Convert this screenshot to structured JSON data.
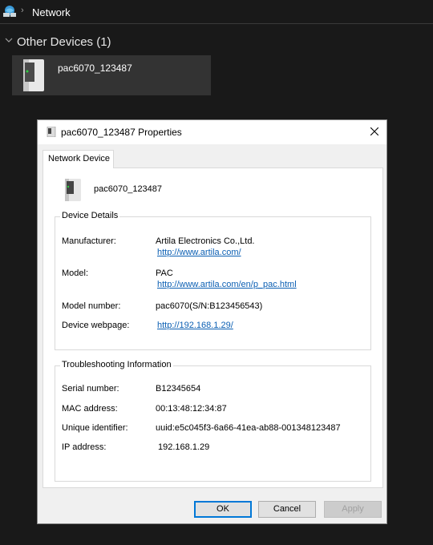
{
  "explorer": {
    "breadcrumb": "Network",
    "group_title": "Other Devices (1)",
    "device_name": "pac6070_123487"
  },
  "dialog": {
    "title": "pac6070_123487 Properties",
    "tab_label": "Network Device",
    "device_name": "pac6070_123487",
    "device_details": {
      "legend": "Device Details",
      "manufacturer_label": "Manufacturer:",
      "manufacturer_value": "Artila Electronics Co.,Ltd.",
      "manufacturer_link": "http://www.artila.com/",
      "model_label": "Model:",
      "model_value": "PAC",
      "model_link": "http://www.artila.com/en/p_pac.html",
      "model_number_label": "Model number:",
      "model_number_value": "pac6070(S/N:B123456543)",
      "webpage_label": "Device webpage:",
      "webpage_link": "http://192.168.1.29/"
    },
    "troubleshooting": {
      "legend": "Troubleshooting Information",
      "serial_label": "Serial number:",
      "serial_value": "B12345654",
      "mac_label": "MAC address:",
      "mac_value": "00:13:48:12:34:87",
      "uid_label": "Unique identifier:",
      "uid_value": "uuid:e5c045f3-6a66-41ea-ab88-001348123487",
      "ip_label": "IP address:",
      "ip_value": "192.168.1.29"
    },
    "buttons": {
      "ok": "OK",
      "cancel": "Cancel",
      "apply": "Apply"
    }
  }
}
